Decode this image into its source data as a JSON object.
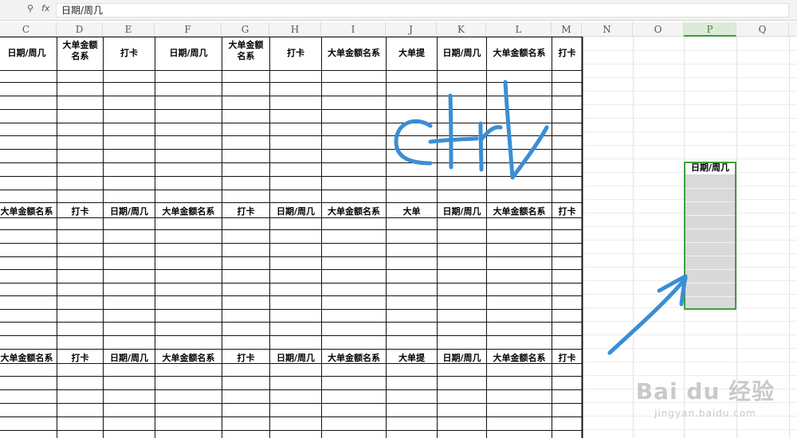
{
  "formula_bar": {
    "zoom_icon": "magnifier-icon",
    "fx_label": "fx",
    "content": "日期/周几"
  },
  "column_headers": [
    "C",
    "D",
    "E",
    "F",
    "G",
    "H",
    "I",
    "J",
    "K",
    "L",
    "M",
    "N",
    "O",
    "P",
    "Q"
  ],
  "selected_column": "P",
  "tables": [
    {
      "headers": [
        "日期/周几",
        "大单金额名系",
        "打卡",
        "日期/周几",
        "大单金额名系",
        "打卡",
        "大单金额名系",
        "大单提",
        "日期/周几",
        "大单金额名系",
        "打卡"
      ]
    },
    {
      "headers": [
        "大单金额名系",
        "打卡",
        "日期/周几",
        "大单金额名系",
        "打卡",
        "日期/周几",
        "大单金额名系",
        "大单",
        "日期/周几",
        "大单金额名系",
        "打卡"
      ]
    },
    {
      "headers": [
        "大单金额名系",
        "打卡",
        "日期/周几",
        "大单金额名系",
        "打卡",
        "日期/周几",
        "大单金额名系",
        "大单提",
        "日期/周几",
        "大单金额名系",
        "打卡"
      ]
    }
  ],
  "p_column_header": "日期/周几",
  "annotation": {
    "handwritten_text": "ctrl",
    "stroke_color": "#3a8ed4",
    "arrow_icon": "arrow-icon"
  },
  "watermark": {
    "main": "Bai du 经验",
    "sub": "jingyan.baidu.com"
  }
}
